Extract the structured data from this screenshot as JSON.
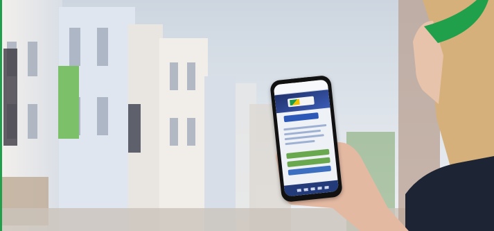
{
  "scene": {
    "subject": "person-holding-smartphone",
    "colors": {
      "sky": "#dfe5ec",
      "accent_green": "#21a04b",
      "banner_green": "#7dc06a",
      "building_light": "#ece8e4",
      "phone_frame": "#111111",
      "sweater": "#1d2433",
      "hair": "#d7b27c",
      "skin": "#e9c6b0"
    }
  }
}
